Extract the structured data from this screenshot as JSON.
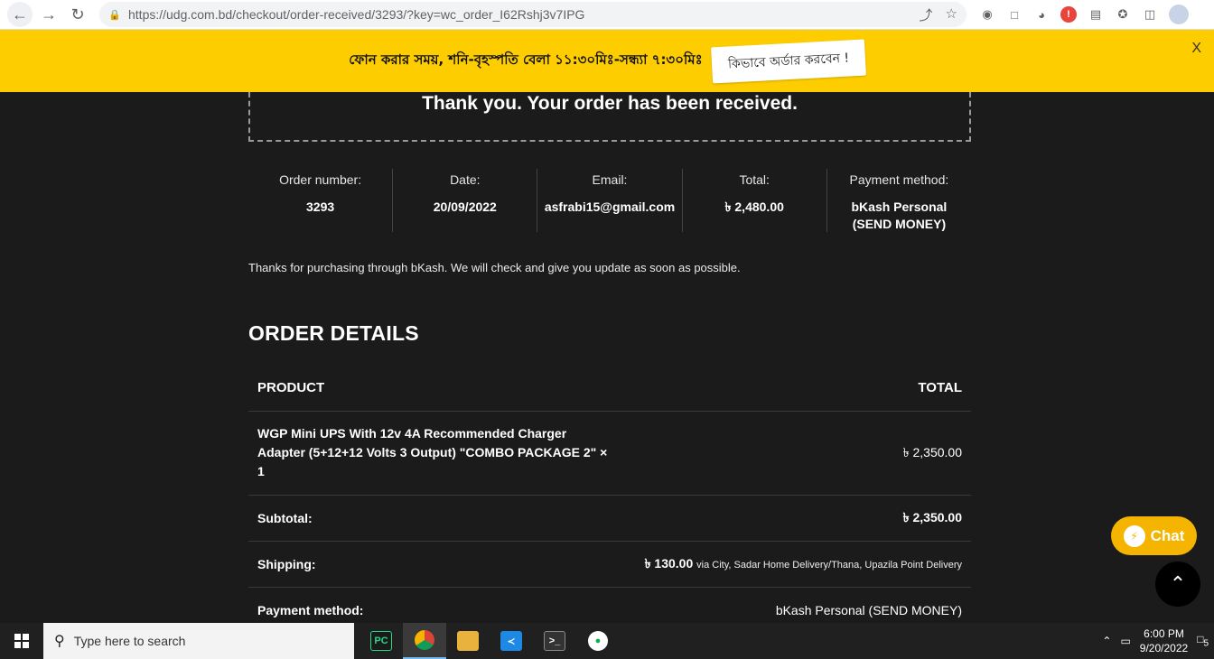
{
  "browser": {
    "url": "https://udg.com.bd/checkout/order-received/3293/?key=wc_order_I62Rshj3v7IPG"
  },
  "notice": {
    "text": "ফোন করার সময়, শনি-বৃহস্পতি বেলা ১১:৩০মিঃ-সন্ধ্যা ৭:৩০মিঃ",
    "button": "কিভাবে অর্ডার করবেন !",
    "close": "X"
  },
  "order": {
    "thanks": "Thank you. Your order has been received.",
    "overview": [
      {
        "label": "Order number:",
        "value": "3293"
      },
      {
        "label": "Date:",
        "value": "20/09/2022"
      },
      {
        "label": "Email:",
        "value": "asfrabi15@gmail.com"
      },
      {
        "label": "Total:",
        "value": "৳ 2,480.00"
      },
      {
        "label": "Payment method:",
        "value": "bKash Personal (SEND MONEY)"
      }
    ],
    "message": "Thanks for purchasing through bKash. We will check and give you update as soon as possible.",
    "details_heading": "ORDER DETAILS",
    "table": {
      "col_product": "PRODUCT",
      "col_total": "TOTAL",
      "product_name": "WGP Mini UPS With 12v 4A Recommended Charger Adapter (5+12+12 Volts 3 Output) \"COMBO PACKAGE 2\" × 1",
      "product_total": "৳ 2,350.00",
      "subtotal_label": "Subtotal:",
      "subtotal_value": "৳ 2,350.00",
      "shipping_label": "Shipping:",
      "shipping_value": "৳ 130.00",
      "shipping_via": "via City, Sadar Home Delivery/Thana, Upazila Point Delivery",
      "payment_label": "Payment method:",
      "payment_value": "bKash Personal (SEND MONEY)"
    }
  },
  "widgets": {
    "chat_label": "Chat"
  },
  "taskbar": {
    "search_placeholder": "Type here to search",
    "time": "6:00 PM",
    "date": "9/20/2022",
    "notif_count": "5"
  }
}
